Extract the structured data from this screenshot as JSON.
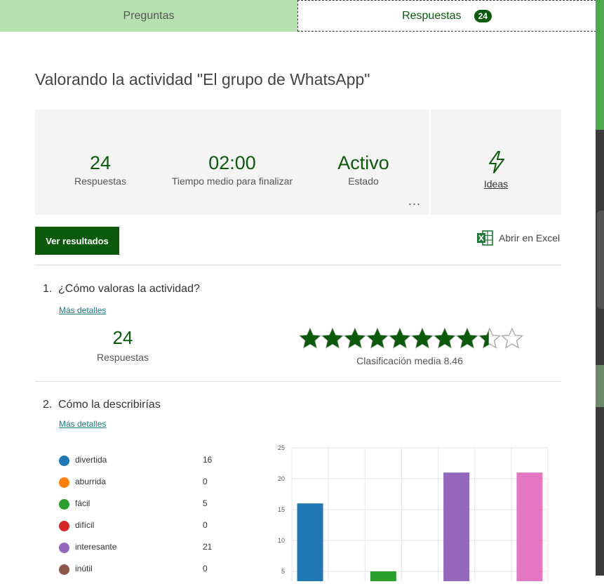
{
  "tabs": {
    "preguntas": "Preguntas",
    "respuestas": "Respuestas",
    "respuestas_badge": "24"
  },
  "form_title": "Valorando la actividad \"El grupo de WhatsApp\"",
  "summary": {
    "responses_value": "24",
    "responses_label": "Respuestas",
    "avg_time_value": "02:00",
    "avg_time_label": "Tiempo medio para finalizar",
    "status_value": "Activo",
    "status_label": "Estado",
    "more_label": "...",
    "ideas_label": "Ideas"
  },
  "actions": {
    "view_results": "Ver resultados",
    "open_excel": "Abrir en Excel"
  },
  "questions": [
    {
      "number": "1.",
      "title": "¿Cómo valoras la actividad?",
      "more_details": "Más detalles",
      "responses_value": "24",
      "responses_label": "Respuestas",
      "rating": 8.46,
      "rating_max": 10,
      "rating_label": "Clasificación media 8.46"
    },
    {
      "number": "2.",
      "title": "Cómo la describirías",
      "more_details": "Más detalles",
      "options": [
        {
          "label": "divertida",
          "count": "16",
          "color": "#1f77b4"
        },
        {
          "label": "aburrida",
          "count": "0",
          "color": "#ff7f0e"
        },
        {
          "label": "fácil",
          "count": "5",
          "color": "#2ca02c"
        },
        {
          "label": "difícil",
          "count": "0",
          "color": "#d62728"
        },
        {
          "label": "interesante",
          "count": "21",
          "color": "#9467bd"
        },
        {
          "label": "inútil",
          "count": "0",
          "color": "#8c564b"
        }
      ]
    }
  ],
  "chart_data": {
    "type": "bar",
    "categories": [
      "divertida",
      "aburrida",
      "fácil",
      "difícil",
      "interesante",
      "inútil",
      ""
    ],
    "values": [
      16,
      0,
      5,
      0,
      21,
      0,
      21
    ],
    "colors": [
      "#1f77b4",
      "#ff7f0e",
      "#2ca02c",
      "#d62728",
      "#9467bd",
      "#8c564b",
      "#e377c2"
    ],
    "ylim": [
      0,
      25
    ],
    "yticks": [
      "5",
      "10",
      "15",
      "20",
      "25"
    ],
    "grid": true
  },
  "colors": {
    "brand_green": "#0b5a0b",
    "tab_inactive_bg": "#b7e0b0",
    "star_empty": "#aaaaaa"
  },
  "icons": {
    "ideas": "lightning-icon",
    "excel": "excel-icon",
    "star": "star-icon"
  }
}
